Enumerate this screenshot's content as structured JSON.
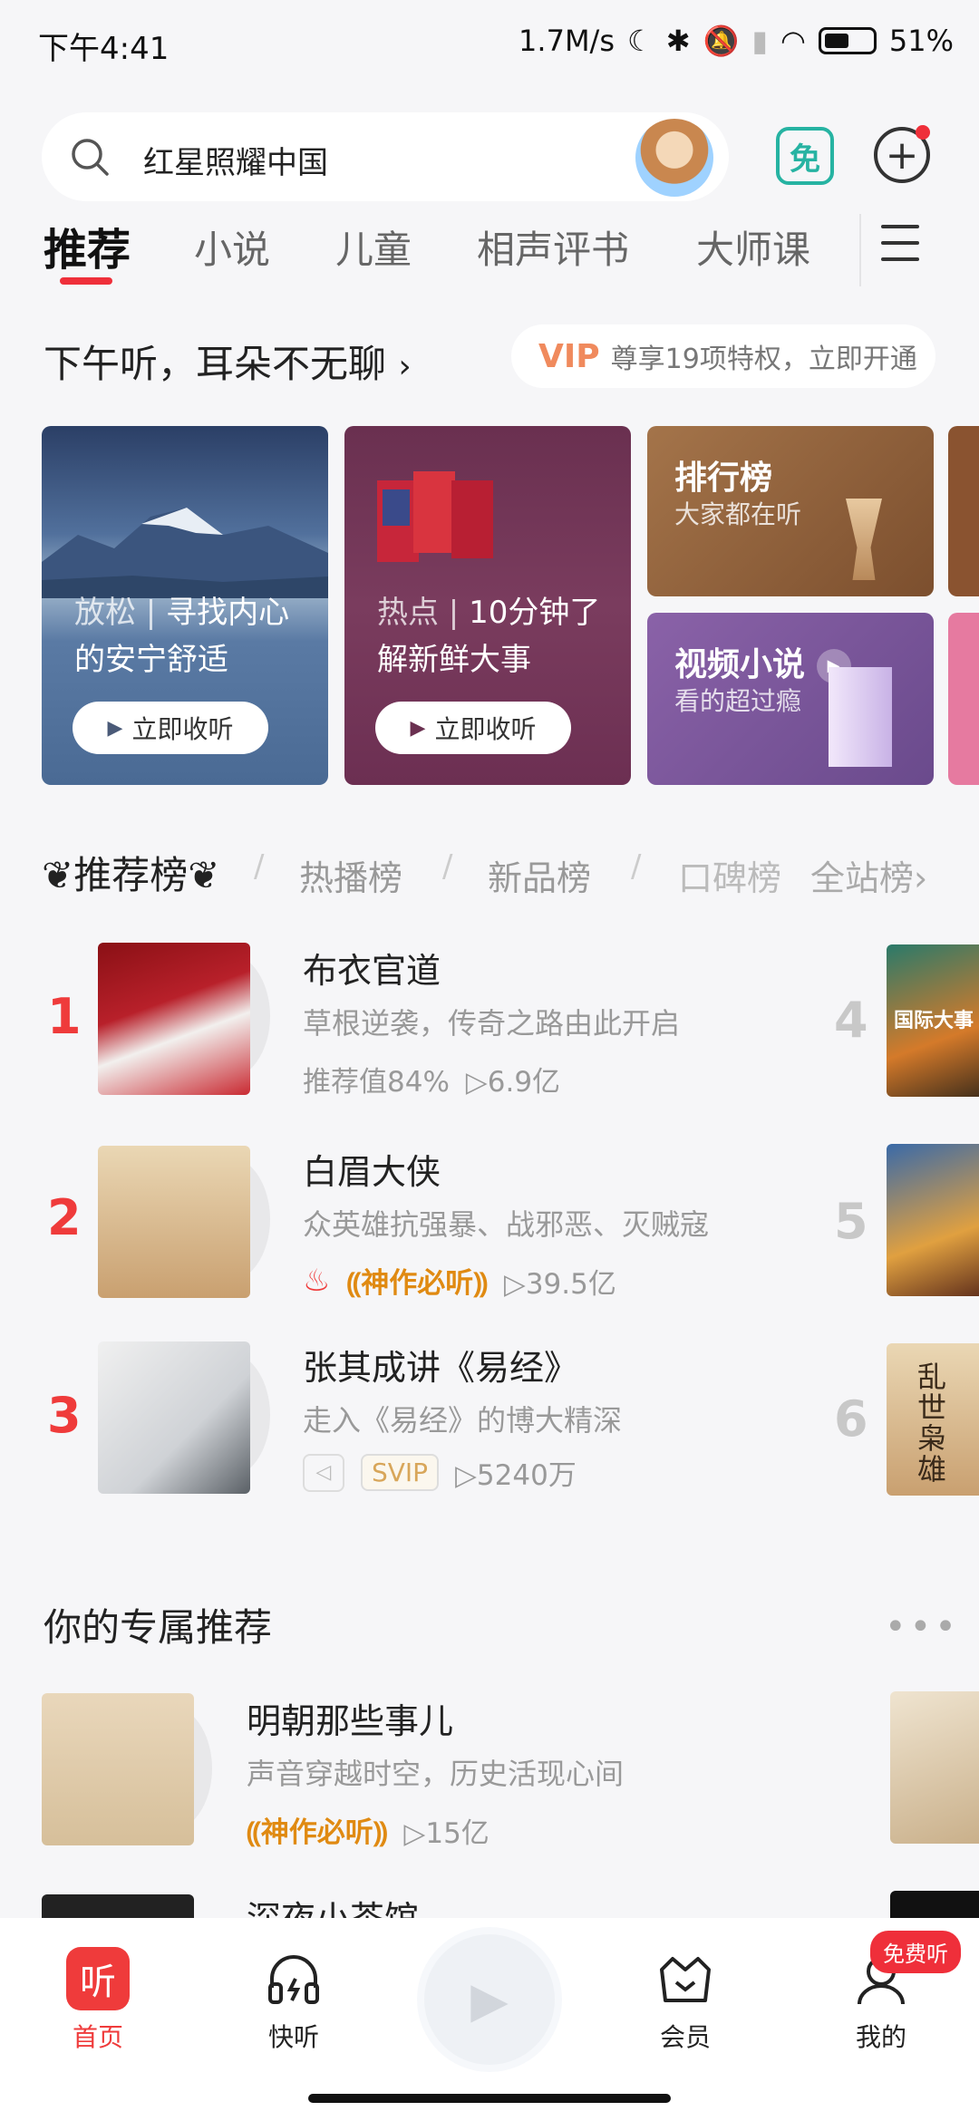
{
  "status_bar": {
    "time": "下午4:41",
    "speed": "1.7M/s",
    "battery": "51%"
  },
  "search": {
    "placeholder": "红星照耀中国",
    "free_label": "免"
  },
  "tabs": [
    "推荐",
    "小说",
    "儿童",
    "相声评书",
    "大师课"
  ],
  "greeting": {
    "text": "下午听，耳朵不无聊",
    "vip_label": "VIP",
    "vip_text": "尊享19项特权，立即开通"
  },
  "feature_cards": [
    {
      "tag": "放松",
      "title_rest": "寻找内心的安宁舒适",
      "button": "立即收听"
    },
    {
      "tag": "热点",
      "title_rest": "10分钟了解新鲜大事",
      "button": "立即收听"
    }
  ],
  "small_cards": [
    {
      "title": "排行榜",
      "subtitle": "大家都在听"
    },
    {
      "title": "视频小说",
      "subtitle": "看的超过瘾"
    }
  ],
  "rank_tabs": [
    "推荐榜",
    "热播榜",
    "新品榜",
    "口碑榜",
    "全站榜"
  ],
  "rank_items": [
    {
      "rank": "1",
      "title": "布衣官道",
      "desc": "草根逆袭，传奇之路由此开启",
      "score": "推荐值84%",
      "plays": "6.9亿"
    },
    {
      "rank": "2",
      "title": "白眉大侠",
      "desc": "众英雄抗强暴、战邪恶、灭贼寇",
      "badge": "神作必听",
      "plays": "39.5亿"
    },
    {
      "rank": "3",
      "title": "张其成讲《易经》",
      "desc": "走入《易经》的博大精深",
      "svip": "SVIP",
      "plays": "5240万"
    }
  ],
  "right_ranks": [
    "4",
    "5",
    "6"
  ],
  "right_cover_texts": [
    "国际大事",
    "乱世枭雄"
  ],
  "section": {
    "title": "你的专属推荐",
    "more": "•••"
  },
  "recommend_items": [
    {
      "title": "明朝那些事儿",
      "desc": "声音穿越时空，历史活现心间",
      "badge": "神作必听",
      "plays": "15亿"
    },
    {
      "title": "深夜小茶馆"
    }
  ],
  "bottom_nav": {
    "home": "首页",
    "quick": "快听",
    "vip": "会员",
    "me": "我的",
    "free_tag": "免费听",
    "home_glyph": "听"
  },
  "colors": {
    "accent": "#ef3b3b",
    "gold": "#e08a12",
    "teal": "#26b3a2"
  }
}
